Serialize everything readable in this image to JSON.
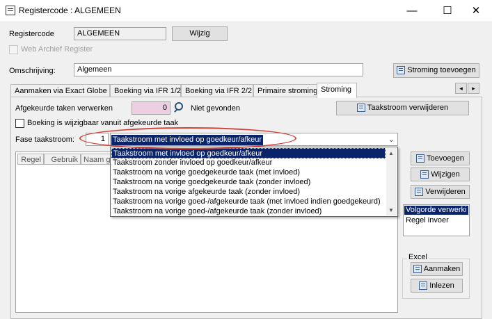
{
  "window": {
    "title": "Registercode : ALGEMEEN",
    "minimize": "—",
    "maximize": "☐",
    "close": "✕"
  },
  "header": {
    "registercode_label": "Registercode",
    "registercode_value": "ALGEMEEN",
    "wijzig_button": "Wijzig",
    "web_archief_label": "Web Archief Register",
    "omschrijving_label": "Omschrijving:",
    "omschrijving_value": "Algemeen",
    "stroming_toevoegen_button": "Stroming toevoegen"
  },
  "tabs": [
    {
      "label": "Aanmaken via Exact Globe"
    },
    {
      "label": "Boeking via IFR 1/2"
    },
    {
      "label": "Boeking via IFR 2/2"
    },
    {
      "label": "Primaire stroming"
    },
    {
      "label": "Stroming"
    }
  ],
  "tab_scroll": {
    "left": "◂",
    "right": "▸"
  },
  "stroming": {
    "afgekeurde_label": "Afgekeurde taken verwerken",
    "afgekeurde_value": "0",
    "niet_gevonden": "Niet gevonden",
    "taakstroom_verwijderen_button": "Taakstroom verwijderen",
    "boeking_wijzigbaar_label": "Boeking is wijzigbaar vanuit afgekeurde taak",
    "fase_label": "Fase taakstroom:",
    "fase_number": "1",
    "fase_selected": "Taakstroom met invloed op goedkeur/afkeur",
    "dropdown_options": [
      "Taakstroom met invloed op goedkeur/afkeur",
      "Taakstroom zonder invloed op goedkeur/afkeur",
      "Taakstroom na vorige goedgekeurde taak (met invloed)",
      "Taakstroom na vorige goedgekeurde taak (zonder invloed)",
      "Taakstroom na vorige afgekeurde taak (zonder invloed)",
      "Taakstroom na vorige goed-/afgekeurde taak (met invloed indien goedgekeurd)",
      "Taakstroom na vorige goed-/afgekeurde taak (zonder invloed)"
    ],
    "grid_columns": [
      "Regel",
      "Gebruik",
      "Naam ge"
    ],
    "toevoegen_button": "Toevoegen",
    "wijzigen_button": "Wijzigen",
    "verwijderen_button": "Verwijderen",
    "list_items": [
      "Volgorde verwerki",
      "Regel invoer"
    ],
    "excel_label": "Excel",
    "aanmaken_button": "Aanmaken",
    "inlezen_button": "Inlezen"
  },
  "colors": {
    "selection": "#0a246a",
    "highlight_ellipse": "#d2453c",
    "disabled_field": "#eccfe0"
  }
}
